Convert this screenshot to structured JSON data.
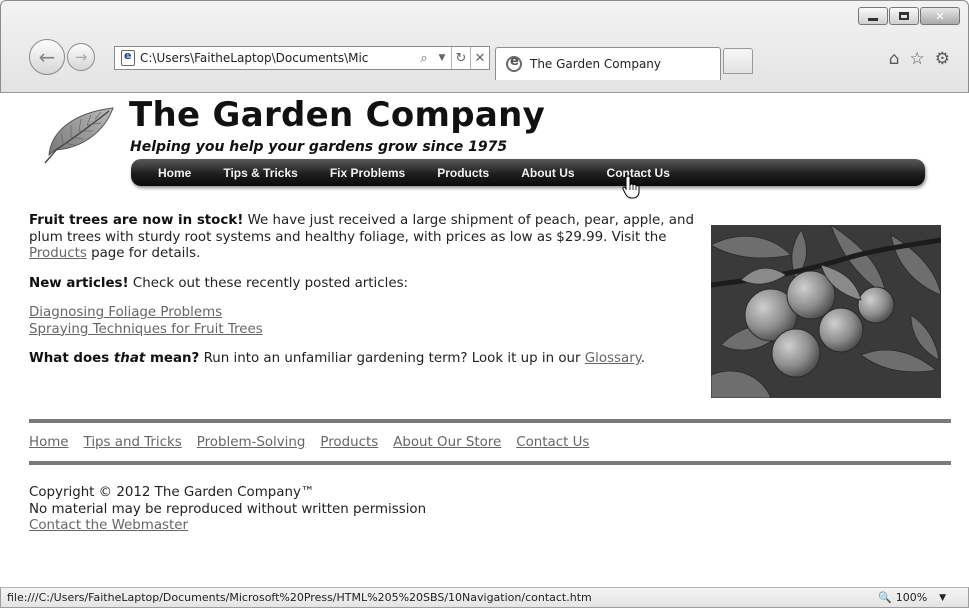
{
  "browser": {
    "address_url": "C:\\Users\\FaitheLaptop\\Documents\\Mic",
    "tab_title": "The Garden Company",
    "status_url": "file:///C:/Users/FaitheLaptop/Documents/Microsoft%20Press/HTML%205%20SBS/10Navigation/contact.htm",
    "zoom": "100%"
  },
  "site": {
    "title": "The Garden Company",
    "tagline": "Helping you help your gardens grow since 1975"
  },
  "nav_bar": [
    "Home",
    "Tips & Tricks",
    "Fix Problems",
    "Products",
    "About Us",
    "Contact Us"
  ],
  "content": {
    "p1_bold": "Fruit trees are now in stock!",
    "p1_text": " We have just received a large shipment of peach, pear, apple, and plum trees with sturdy root systems and healthy foliage, with prices as low as $29.99. Visit the ",
    "p1_link": "Products",
    "p1_end": " page for details.",
    "p2_bold": "New articles!",
    "p2_text": " Check out these recently posted articles:",
    "article_links": [
      "Diagnosing Foliage Problems",
      "Spraying Techniques for Fruit Trees"
    ],
    "p3_bold_a": "What does ",
    "p3_italic": "that",
    "p3_bold_b": " mean?",
    "p3_text": " Run into an unfamiliar gardening term? Look it up in our ",
    "p3_link": "Glossary",
    "p3_end": "."
  },
  "footer_nav": [
    "Home",
    "Tips and Tricks",
    "Problem-Solving",
    "Products",
    "About Our Store",
    "Contact Us"
  ],
  "footer": {
    "copyright": "Copyright © 2012 The Garden Company™",
    "notice": "No material may be reproduced without written permission",
    "webmaster_link": "Contact the Webmaster"
  },
  "icons": {
    "back": "back-arrow-icon",
    "forward": "forward-arrow-icon",
    "search": "search-icon",
    "dropdown": "dropdown-icon",
    "refresh": "refresh-icon",
    "stop": "stop-icon",
    "home": "home-icon",
    "favorites": "star-icon",
    "tools": "gear-icon",
    "zoom": "magnifier-icon"
  }
}
